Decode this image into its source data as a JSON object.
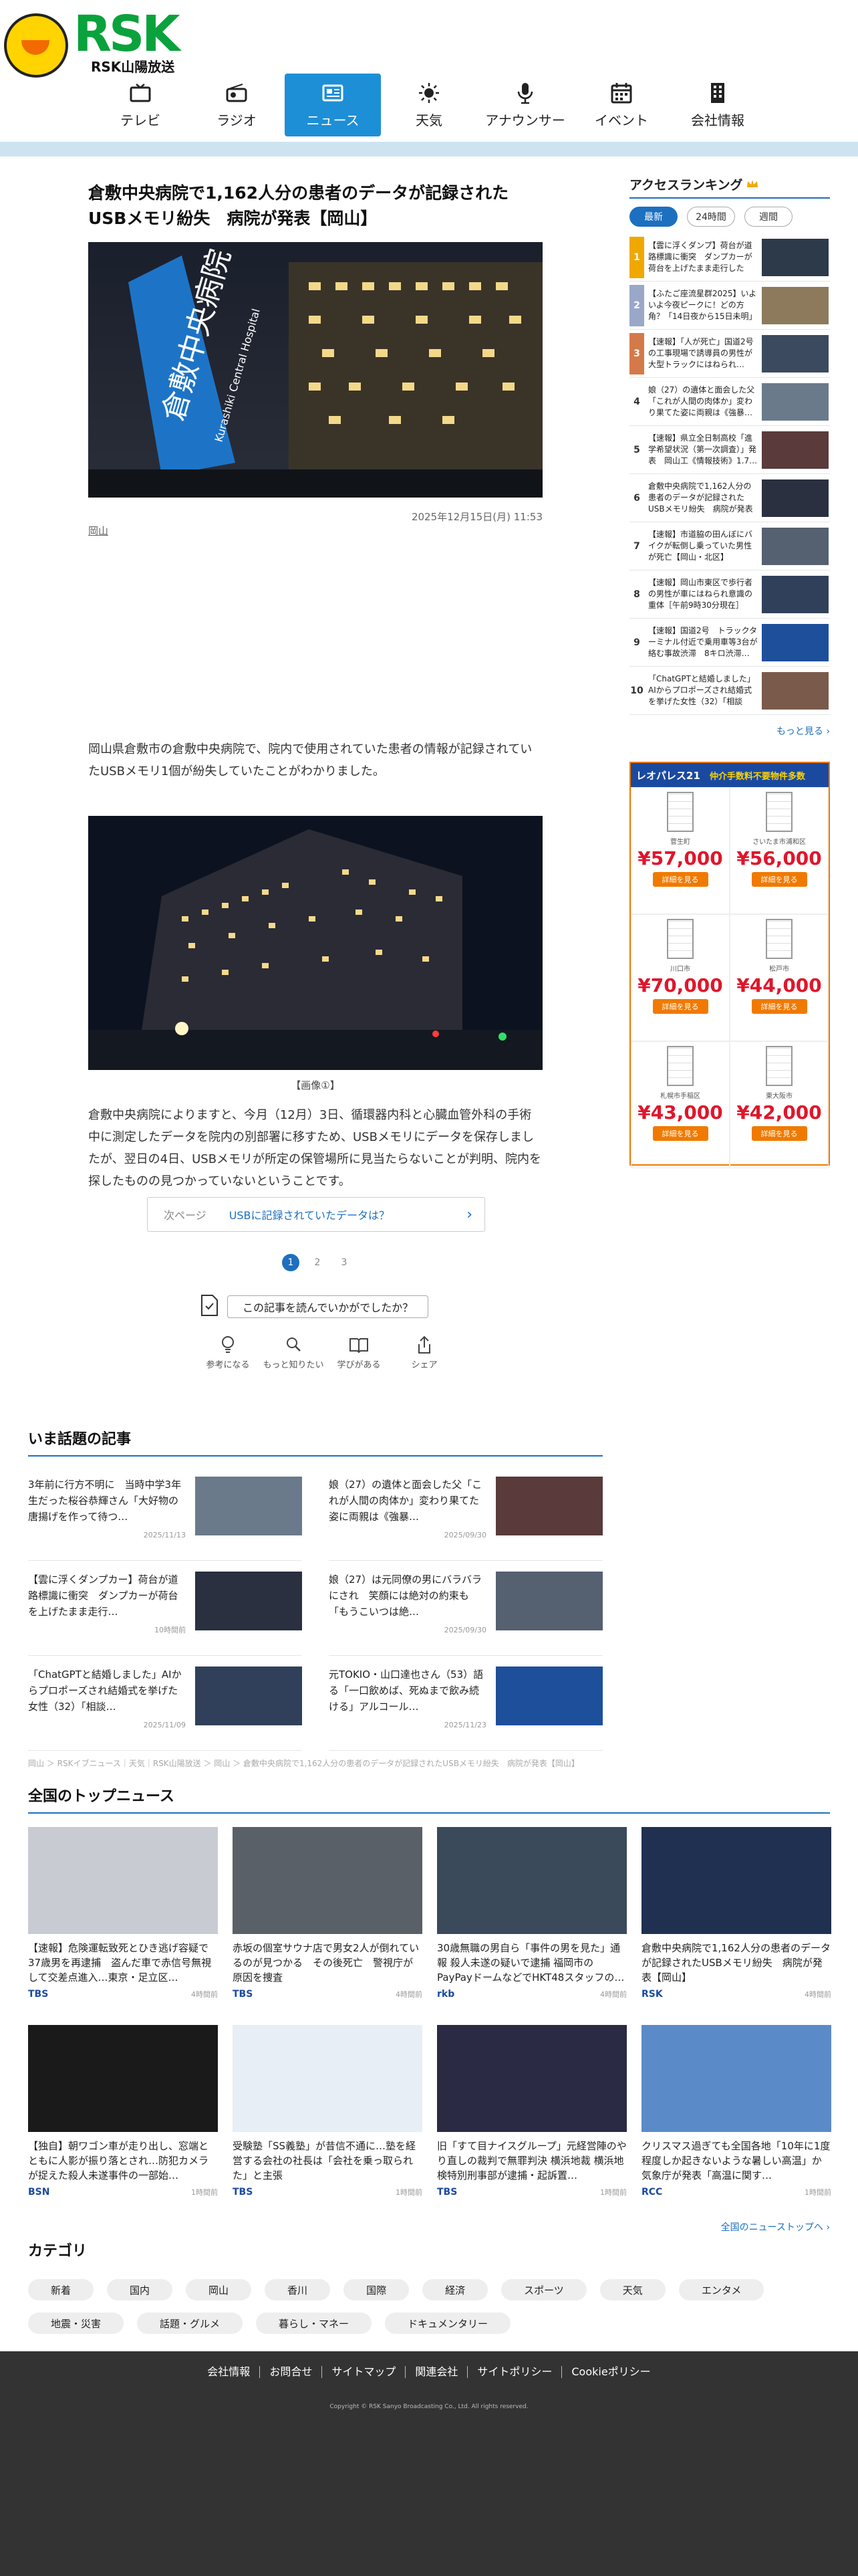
{
  "brand": {
    "name": "RSK",
    "sub": "RSK山陽放送",
    "mascot_label": "RSK"
  },
  "nav": [
    {
      "label": "テレビ",
      "icon": "tv-icon"
    },
    {
      "label": "ラジオ",
      "icon": "radio-icon"
    },
    {
      "label": "ニュース",
      "icon": "news-icon",
      "active": true
    },
    {
      "label": "天気",
      "icon": "sun-icon"
    },
    {
      "label": "アナウンサー",
      "icon": "microphone-icon"
    },
    {
      "label": "イベント",
      "icon": "calendar-icon"
    },
    {
      "label": "会社情報",
      "icon": "building-icon"
    }
  ],
  "article": {
    "title": "倉敷中央病院で1,162人分の患者のデータが記録されたUSBメモリ紛失　病院が発表【岡山】",
    "hero_sign": "倉敷中央病院",
    "hero_sign_en": "Kurashiki Central Hospital",
    "date": "2025年12月15日(月) 11:53",
    "category": "岡山",
    "para1": "岡山県倉敷市の倉敷中央病院で、院内で使用されていた患者の情報が記録されていたUSBメモリ1個が紛失していたことがわかりました。",
    "caption": "【画像①】",
    "para2": "倉敷中央病院によりますと、今月（12月）3日、循環器内科と心臓血管外科の手術中に測定したデータを院内の別部署に移すため、USBメモリにデータを保存しましたが、翌日の4日、USBメモリが所定の保管場所に見当たらないことが判明、院内を探したものの見つかっていないということです。",
    "next_label": "次ページ",
    "next_title": "USBに記録されていたデータは？",
    "pages": [
      "1",
      "2",
      "3"
    ],
    "reaction_q": "この記事を読んでいかがでしたか？",
    "reactions": [
      {
        "label": "参考になる",
        "icon": "lightbulb-icon"
      },
      {
        "label": "もっと知りたい",
        "icon": "magnifier-icon"
      },
      {
        "label": "学びがある",
        "icon": "book-icon"
      },
      {
        "label": "シェア",
        "icon": "share-icon"
      }
    ]
  },
  "ranking": {
    "title": "アクセスランキング",
    "tabs": [
      "最新",
      "24時間",
      "週間"
    ],
    "items": [
      {
        "n": "1",
        "t": "【雲に浮くダンプ】荷台が道路標識に衝突　ダンプカーが荷台を上げたまま走行した か…"
      },
      {
        "n": "2",
        "t": "【ふたご座流星群2025】いよいよ今夜ピークに！どの方角？「14日夜から15日未明」見…"
      },
      {
        "n": "3",
        "t": "【速報】「人が死亡」国道2号の工事現場で誘導員の男性が大型トラックにはねられ…"
      },
      {
        "n": "4",
        "t": "娘（27）の遺体と面会した父「これが人間の肉体か」変わり果てた姿に両親は《強暴…"
      },
      {
        "n": "5",
        "t": "【速報】県立全日制高校「進学希望状況（第一次調査）」発表　岡山工《情報技術》1.7…"
      },
      {
        "n": "6",
        "t": "倉敷中央病院で1,162人分の患者のデータが記録されたUSBメモリ紛失　病院が発表【岡…"
      },
      {
        "n": "7",
        "t": "【速報】市道脇の田んぼにバイクが転倒し乗っていた男性が死亡【岡山・北区】"
      },
      {
        "n": "8",
        "t": "【速報】岡山市東区で歩行者の男性が車にはねられ意識の重体［午前9時30分現在］"
      },
      {
        "n": "9",
        "t": "【速報】国道2号　トラックターミナル付近で乗用車等3台が絡む事故渋滞　8キロ渋滞…"
      },
      {
        "n": "10",
        "t": "「ChatGPTと結婚しました」AIからプロポーズされ結婚式を挙げた女性（32）「相談し…"
      }
    ],
    "more": "もっと見る"
  },
  "ad": {
    "brand": "レオパレス21",
    "tagline": "仲介手数料不要物件多数",
    "items": [
      {
        "area": "菅生町",
        "price": "¥57,000",
        "btn": "詳細を見る"
      },
      {
        "area": "さいたま市浦和区",
        "price": "¥56,000",
        "btn": "詳細を見る"
      },
      {
        "area": "川口市",
        "price": "¥70,000",
        "btn": "詳細を見る"
      },
      {
        "area": "松戸市",
        "price": "¥44,000",
        "btn": "詳細を見る"
      },
      {
        "area": "札幌市手稲区",
        "price": "¥43,000",
        "btn": "詳細を見る"
      },
      {
        "area": "東大阪市",
        "price": "¥42,000",
        "btn": "詳細を見る"
      }
    ]
  },
  "ima": {
    "title": "いま話題の記事",
    "items": [
      {
        "t": "3年前に行方不明に　当時中学3年生だった桜谷恭輝さん「大好物の唐揚げを作って待つ…",
        "d": "2025/11/13"
      },
      {
        "t": "娘（27）の遺体と面会した父「これが人間の肉体か」変わり果てた姿に両親は《強暴…",
        "d": "2025/09/30"
      },
      {
        "t": "【雲に浮くダンプカー】荷台が道路標識に衝突　ダンプカーが荷台を上げたまま走行…",
        "d": "10時間前"
      },
      {
        "t": "娘（27）は元同僚の男にバラバラにされ　笑顔には絶対の約束も「もうこいつは絶…",
        "d": "2025/09/30"
      },
      {
        "t": "「ChatGPTと結婚しました」AIからプロポーズされ結婚式を挙げた女性（32）「相談…",
        "d": "2025/11/09"
      },
      {
        "t": "元TOKIO・山口達也さん（53）語る「一口飲めば、死ぬまで飲み続ける」アルコール…",
        "d": "2025/11/23"
      }
    ]
  },
  "breadcrumb": "岡山 ＞ RSKイブニュース｜天気｜RSK山陽放送 ＞ 岡山 ＞ 倉敷中央病院で1,162人分の患者のデータが記録されたUSBメモリ紛失　病院が発表【岡山】",
  "top": {
    "title": "全国のトップニュース",
    "items": [
      {
        "t": "【速報】危険運転致死とひき逃げ容疑で37歳男を再逮捕　盗んだ車で赤信号無視して交差点進入…東京・足立区…",
        "src": "TBS",
        "d": "4時間前"
      },
      {
        "t": "赤坂の個室サウナ店で男女2人が倒れているのが見つかる　その後死亡　警視庁が原因を捜査",
        "src": "TBS",
        "d": "4時間前"
      },
      {
        "t": "30歳無職の男自ら「事件の男を見た」通報 殺人未遂の疑いで逮捕 福岡市のPayPayドームなどでHKT48スタッフの…",
        "src": "rkb",
        "d": "4時間前"
      },
      {
        "t": "倉敷中央病院で1,162人分の患者のデータが記録されたUSBメモリ紛失　病院が発表【岡山】",
        "src": "RSK",
        "d": "4時間前"
      },
      {
        "t": "【独自】朝ワゴン車が走り出し、窓端とともに人影が振り落とされ…防犯カメラが捉えた殺人未遂事件の一部始…",
        "src": "BSN",
        "d": "1時間前"
      },
      {
        "t": "受験塾「SS義塾」が昔信不通に…塾を経営する会社の社長は「会社を乗っ取られた」と主張",
        "src": "TBS",
        "d": "1時間前"
      },
      {
        "t": "旧「すて目ナイスグループ」元経営陣のやり直しの裁判で無罪判決 横浜地裁 横浜地検特別刑事部が逮捕・起訴置…",
        "src": "TBS",
        "d": "1時間前"
      },
      {
        "t": "クリスマス過ぎても全国各地「10年に1度程度しか起きないような暑しい高温」か　気象庁が発表「高温に関す…",
        "src": "RCC",
        "d": "1時間前"
      }
    ],
    "more": "全国のニューストップへ"
  },
  "categories": {
    "title": "カテゴリ",
    "items": [
      "新着",
      "国内",
      "岡山",
      "香川",
      "国際",
      "経済",
      "スポーツ",
      "天気",
      "エンタメ",
      "地震・災害",
      "話題・グルメ",
      "暮らし・マネー",
      "ドキュメンタリー"
    ]
  },
  "footer": {
    "links": [
      "会社情報",
      "お問合せ",
      "サイトマップ",
      "関連会社",
      "サイトポリシー",
      "Cookieポリシー"
    ],
    "copyright": "Copyright © RSK Sanyo Broadcasting Co., Ltd. All rights reserved."
  },
  "colors": {
    "accent": "#1d8fd6",
    "link": "#1d6fbf",
    "brand": "#0aa23c",
    "price": "#e0162b",
    "ad_orange": "#f07a00"
  }
}
